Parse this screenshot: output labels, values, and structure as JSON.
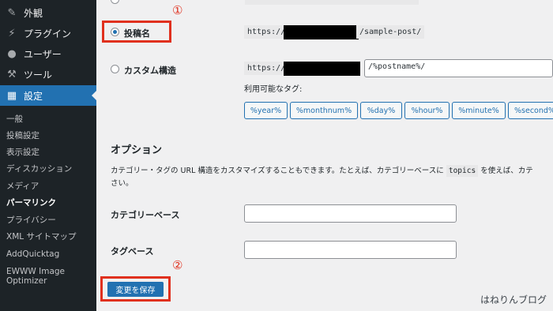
{
  "sidebar": {
    "menu": [
      {
        "label": "外観",
        "icon": "paintbrush-icon"
      },
      {
        "label": "プラグイン",
        "icon": "plugin-icon"
      },
      {
        "label": "ユーザー",
        "icon": "user-icon"
      },
      {
        "label": "ツール",
        "icon": "wrench-icon"
      },
      {
        "label": "設定",
        "icon": "settings-icon"
      }
    ],
    "submenu": [
      "一般",
      "投稿設定",
      "表示設定",
      "ディスカッション",
      "メディア",
      "パーマリンク",
      "プライバシー",
      "XML サイトマップ",
      "AddQuicktag",
      "EWWW Image Optimizer"
    ],
    "current": "パーマリンク"
  },
  "annotations": {
    "marker1": "①",
    "marker2": "②"
  },
  "permalink": {
    "post_name_label": "投稿名",
    "post_name_prefix": "https://",
    "post_name_suffix": "/sample-post/",
    "custom_label": "カスタム構造",
    "custom_prefix": "https://",
    "custom_value": "/%postname%/",
    "tags_label": "利用可能なタグ:",
    "tags": [
      "%year%",
      "%monthnum%",
      "%day%",
      "%hour%",
      "%minute%",
      "%second%"
    ]
  },
  "options": {
    "heading": "オプション",
    "desc_line1": "カテゴリー・タグの URL 構造をカスタマイズすることもできます。たとえば、カテゴリーベースに",
    "desc_code": "topics",
    "desc_line1_end": "を使えば、カテ",
    "desc_line2": "さい。",
    "category_base_label": "カテゴリーベース",
    "category_base_value": "",
    "tag_base_label": "タグベース",
    "tag_base_value": ""
  },
  "save_label": "変更を保存",
  "watermark": "はねりんブログ",
  "colors": {
    "accent": "#2271b1",
    "annotation": "#e0301e",
    "sidebar": "#1d2327"
  }
}
